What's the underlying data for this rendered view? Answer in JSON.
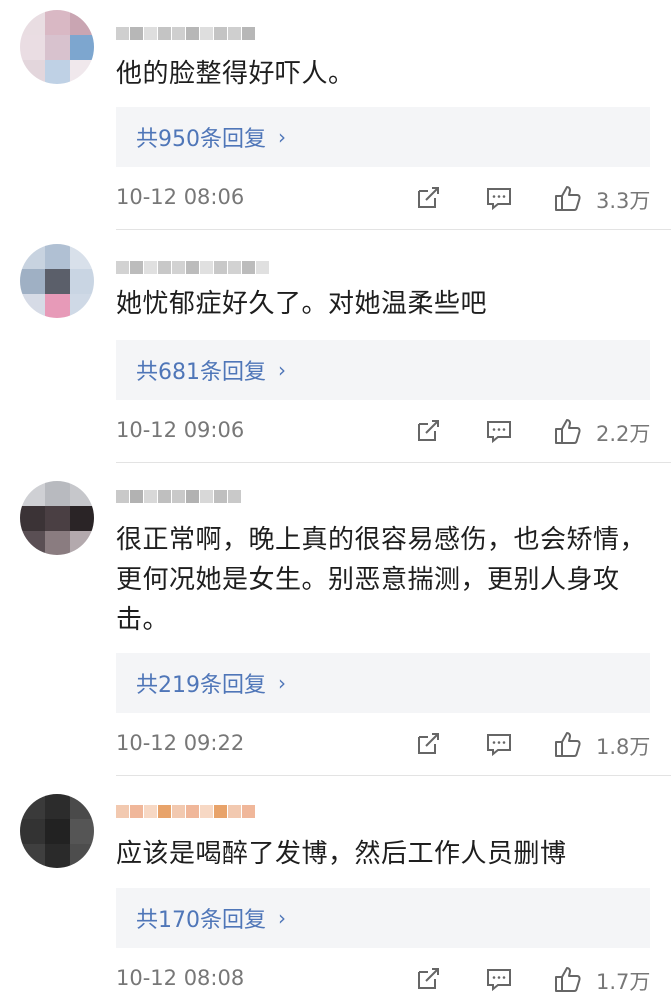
{
  "comments": [
    {
      "text": "他的脸整得好吓人。",
      "replies": "共950条回复",
      "time": "10-12 08:06",
      "likes": "3.3万",
      "avatar_colors": [
        "#e9dde2",
        "#d9b8c4",
        "#c9a5b2",
        "#eadde3",
        "#d8c2ce",
        "#7da6cf",
        "#e3d6dc",
        "#bfd1e5",
        "#f0e8ec"
      ]
    },
    {
      "text": "她忧郁症好久了。对她温柔些吧",
      "replies": "共681条回复",
      "time": "10-12 09:06",
      "likes": "2.2万",
      "avatar_colors": [
        "#c8d3e0",
        "#b0c0d3",
        "#d8e0ea",
        "#9fb0c4",
        "#5b5f6a",
        "#c9d5e3",
        "#d6dbe6",
        "#e79ab8",
        "#cfd9e6"
      ]
    },
    {
      "text": "很正常啊，晚上真的很容易感伤，也会矫情，更何况她是女生。别恶意揣测，更别人身攻击。",
      "replies": "共219条回复",
      "time": "10-12 09:22",
      "likes": "1.8万",
      "avatar_colors": [
        "#cfd0d4",
        "#b8babf",
        "#c6c7cb",
        "#3b3336",
        "#4a3f43",
        "#2a2426",
        "#5a4f54",
        "#8a7c80",
        "#b3a9ad"
      ]
    },
    {
      "text": "应该是喝醉了发博，然后工作人员删博",
      "replies": "共170条回复",
      "time": "10-12 08:08",
      "likes": "1.7万",
      "avatar_colors": [
        "#3a3a3a",
        "#2c2c2c",
        "#4a4a4a",
        "#333333",
        "#222222",
        "#555555",
        "#3f3f3f",
        "#2a2a2a",
        "#4d4d4d"
      ]
    }
  ],
  "colors": {
    "reply_link": "#4f76b8",
    "reply_bg": "#f4f5f7",
    "meta_text": "#777777"
  },
  "icons": {
    "share": "share-icon",
    "comment": "comment-icon",
    "like": "thumbs-up-icon"
  }
}
